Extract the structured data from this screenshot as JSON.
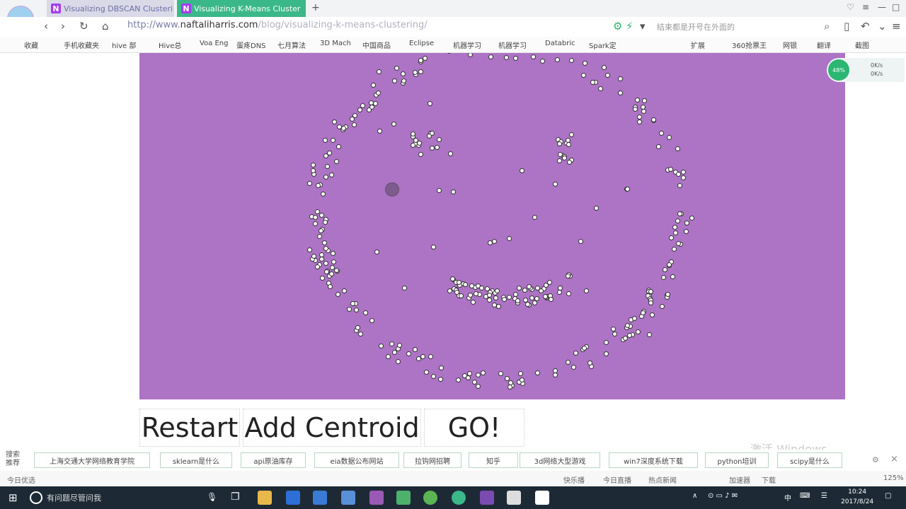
{
  "browser": {
    "tabs": [
      {
        "label": "Visualizing DBSCAN Clusteri",
        "icon": "N"
      },
      {
        "label": "Visualizing K-Means Cluster",
        "icon": "N"
      }
    ],
    "url_prefix": "http://www.",
    "url_domain": "naftaliharris.com",
    "url_path": "/blog/visualizing-k-means-clustering/",
    "search_hint": "结束都是开号在外面的"
  },
  "bookmarks": [
    "收藏",
    "手机收藏夹",
    "hive 部",
    "Hive总",
    "Voa Eng",
    "蛋疼DNS",
    "七月算法",
    "3D Mach",
    "中国商品",
    "Eclipse",
    "机器学习",
    "机器学习",
    "Databric",
    "Spark定",
    "扩展",
    "360抢票王",
    "网银",
    "翻译",
    "截图"
  ],
  "side_widget": {
    "speed_up": "0K/s",
    "speed_down": "0K/s",
    "ball": "48%"
  },
  "buttons": {
    "restart": "Restart",
    "add_centroid": "Add Centroid",
    "go": "GO!"
  },
  "suggest": {
    "label_line1": "搜索",
    "label_line2": "推荐",
    "chips": [
      "上海交通大学网络教育学院",
      "sklearn是什么",
      "api原油库存",
      "eia数据公布网站",
      "拉钩网招聘",
      "知乎",
      "3d网络大型游戏",
      "win7深度系统下载",
      "python培训",
      "scipy是什么"
    ]
  },
  "statusbar": {
    "left": "今日优选",
    "items": [
      "快乐播",
      "今日直播",
      "热点新闻",
      "加速器",
      "下载"
    ],
    "zoom": "125%"
  },
  "taskbar": {
    "search": "有问题尽管问我",
    "time": "10:24",
    "date": "2017/8/24",
    "ime": "中"
  },
  "watermark": "激活 Windows",
  "colors": {
    "canvas": "#ad73c5",
    "tab_active": "#3bb889"
  }
}
